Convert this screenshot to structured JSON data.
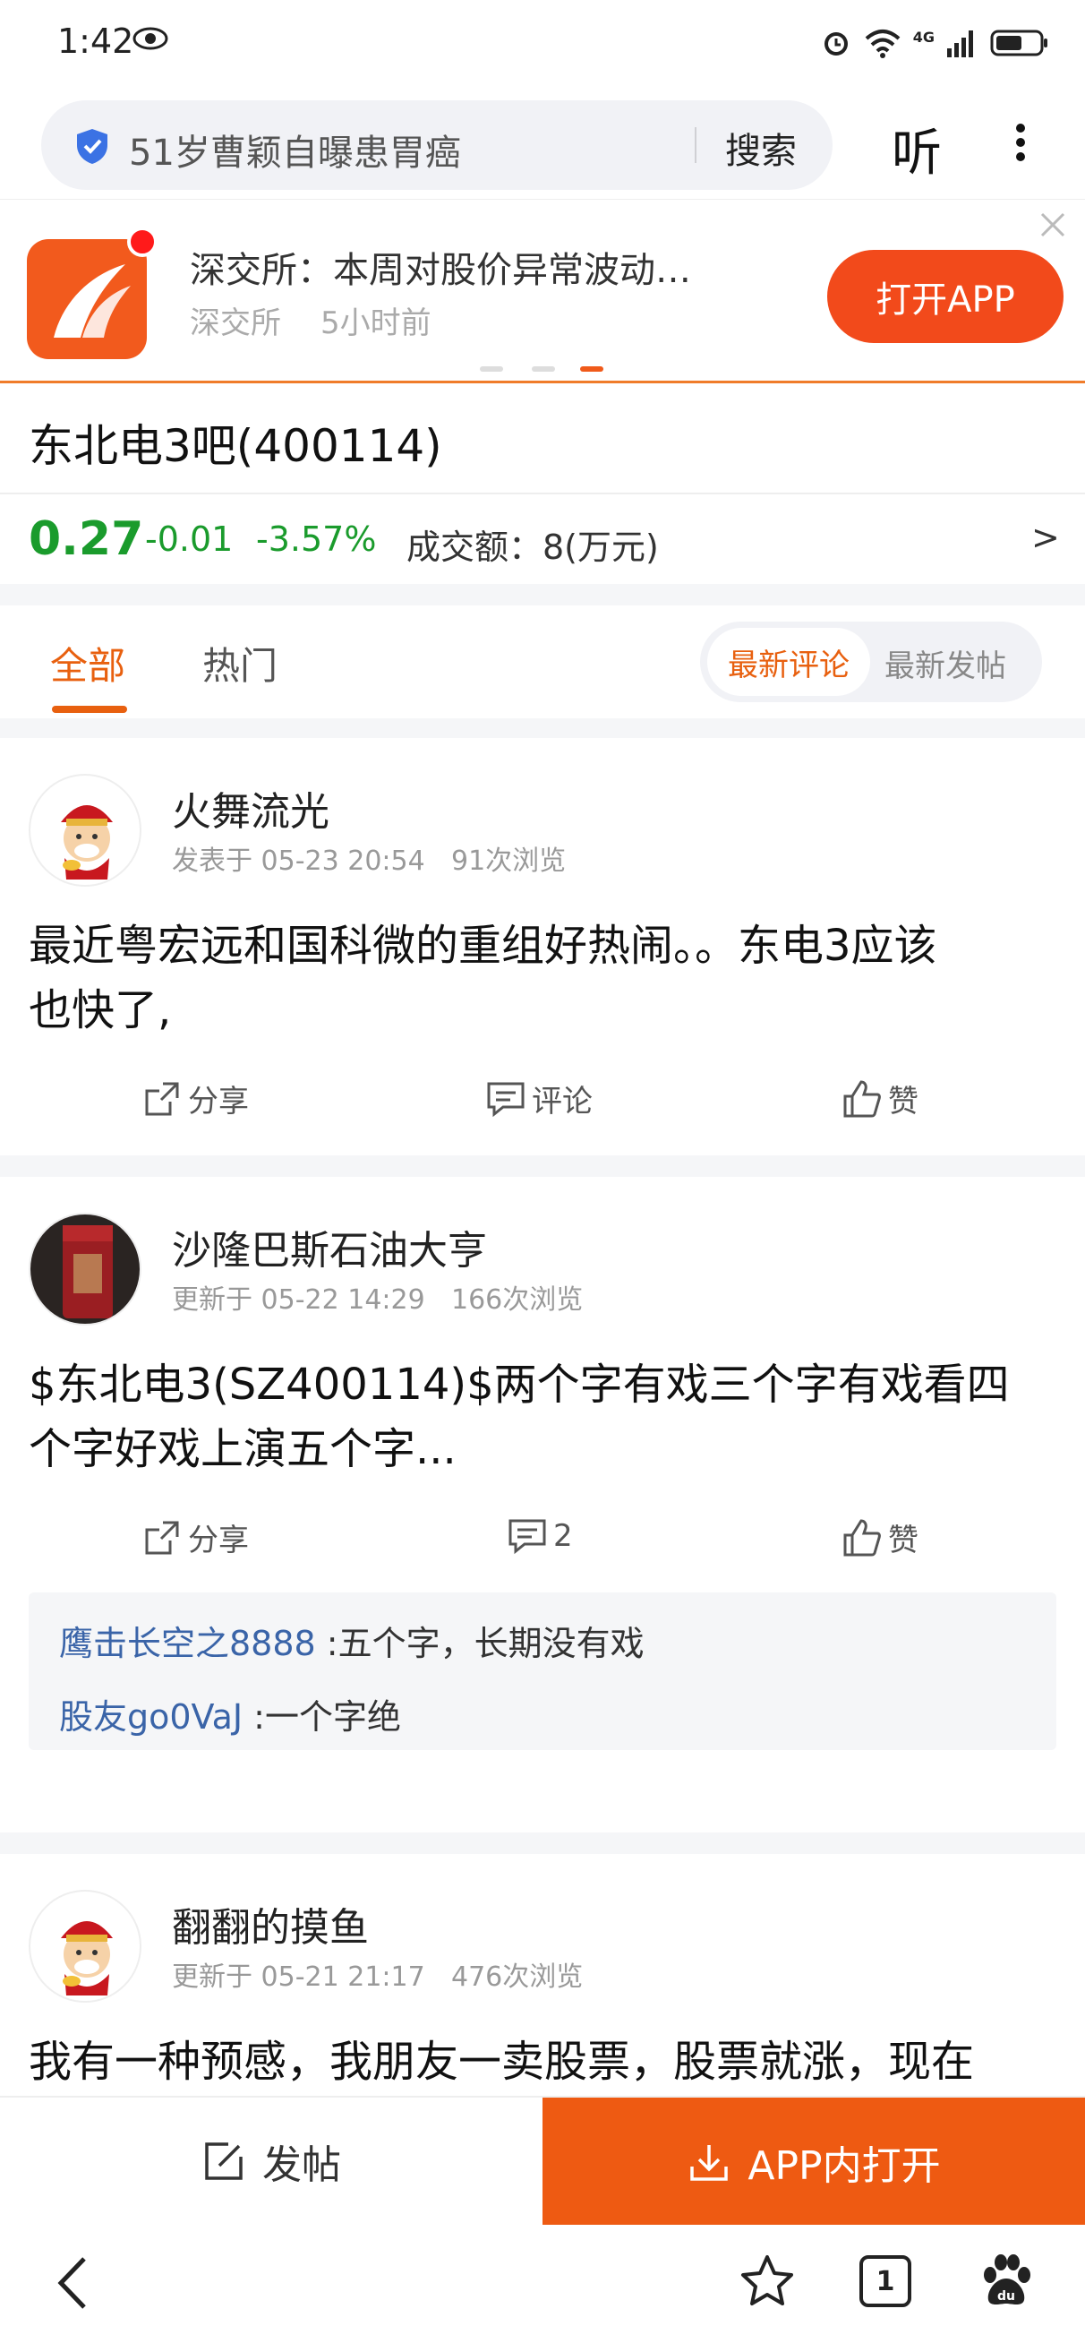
{
  "status": {
    "time": "1:42",
    "network": "4G"
  },
  "search": {
    "query": "51岁曹颖自曝患胃癌",
    "button": "搜索",
    "listen": "听"
  },
  "banner": {
    "title": "深交所：本周对股价异常波动…",
    "source": "深交所",
    "age": "5小时前",
    "open_app": "打开APP"
  },
  "stock": {
    "title": "东北电3吧(400114)",
    "price": "0.27",
    "change": "-0.01",
    "percent": "-3.57%",
    "volume": "成交额：8(万元)",
    "arrow": ">"
  },
  "tabs": {
    "all": "全部",
    "hot": "热门",
    "latest_comment": "最新评论",
    "latest_post": "最新发帖"
  },
  "posts": [
    {
      "user": "火舞流光",
      "meta": "发表于 05-23 20:54",
      "views": "91次浏览",
      "content": [
        "最近粤宏远和国科微的重组好热闹。。东电3应该",
        "也快了,"
      ],
      "share": "分享",
      "comment": "评论",
      "like": "赞"
    },
    {
      "user": "沙隆巴斯石油大亨",
      "meta": "更新于 05-22 14:29",
      "views": "166次浏览",
      "content": [
        "$东北电3(SZ400114)$两个字有戏三个字有戏看四",
        "个字好戏上演五个字..."
      ],
      "share": "分享",
      "comment": "2",
      "like": "赞",
      "replies": [
        {
          "user": "鹰击长空之8888",
          "text": " :五个字，长期没有戏"
        },
        {
          "user": "股友go0VaJ",
          "text": " :一个字绝"
        }
      ]
    },
    {
      "user": "翻翻的摸鱼",
      "meta": "更新于 05-21 21:17",
      "views": "476次浏览",
      "content": [
        "我有一种预感，我朋友一卖股票，股票就涨，现在"
      ]
    }
  ],
  "bottom": {
    "post": "发帖",
    "open_in_app": "APP内打开",
    "tab_count": "1"
  },
  "colors": {
    "accent": "#e8600f",
    "down": "#1a9b2c",
    "app_button": "#ee5a12",
    "link": "#3a64a8"
  }
}
